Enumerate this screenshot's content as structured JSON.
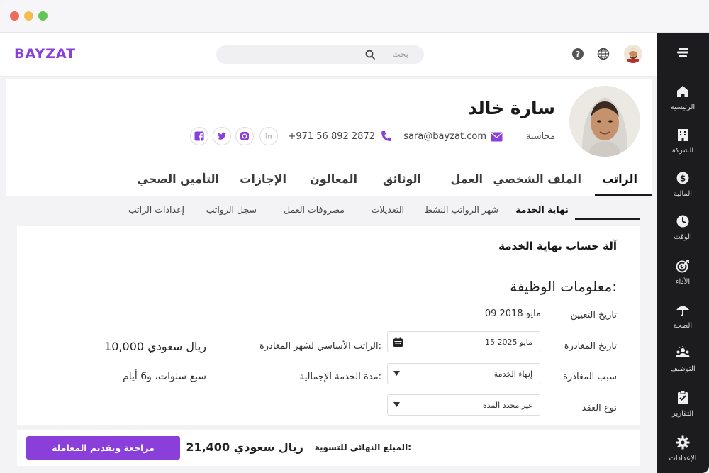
{
  "header": {
    "logo": "BAYZAT",
    "search_placeholder": "بحث"
  },
  "profile": {
    "name": "سارة خالد",
    "role": "محاسبة",
    "email": "sara@bayzat.com",
    "phone": "+971 56 892 2872"
  },
  "tabs": [
    {
      "label": "الراتب"
    },
    {
      "label": "الملف الشخصي"
    },
    {
      "label": "العمل"
    },
    {
      "label": "الوثائق"
    },
    {
      "label": "المعالون"
    },
    {
      "label": "الإجازات"
    },
    {
      "label": "التأمين الصحي"
    }
  ],
  "subtabs": [
    {
      "label": "نهاية الخدمة"
    },
    {
      "label": "شهر الرواتب النشط"
    },
    {
      "label": "التعديلات"
    },
    {
      "label": "مصروفات العمل"
    },
    {
      "label": "سجل الرواتب"
    },
    {
      "label": "إعدادات الراتب"
    }
  ],
  "calculator": {
    "title": "آلة حساب نهاية الخدمة",
    "section_title": "معلومات الوظيفة:",
    "hire_date_label": "تاريخ التعيين",
    "hire_date_value": "09 مايو 2018",
    "departure_date_label": "تاريخ المغادرة",
    "departure_date_value": "15 مايو 2025",
    "departure_reason_label": "سبب المغادرة",
    "departure_reason_value": "إنهاء الخدمة",
    "contract_type_label": "نوع العقد",
    "contract_type_value": "غير محدد المدة",
    "base_salary_label": "الراتب الأساسي لشهر المغادرة:",
    "base_salary_value": "10,000 ريال سعودي",
    "service_duration_label": "مدة الخدمة الإجمالية:",
    "service_duration_value": "سبع سنوات، و6 أيام"
  },
  "settlement": {
    "label": "المبلغ النهائي للتسوية:",
    "amount": "21,400 ريال سعودي",
    "submit_label": "مراجعة وتقديم المعاملة"
  },
  "sidebar": {
    "items": [
      {
        "label": "الرئيسية",
        "icon": "home-icon"
      },
      {
        "label": "الشركة",
        "icon": "building-icon"
      },
      {
        "label": "المالية",
        "icon": "dollar-icon"
      },
      {
        "label": "الوقت",
        "icon": "clock-icon"
      },
      {
        "label": "الأداء",
        "icon": "target-icon"
      },
      {
        "label": "الصحة",
        "icon": "umbrella-icon"
      },
      {
        "label": "التوظيف",
        "icon": "people-icon"
      },
      {
        "label": "التقارير",
        "icon": "clipboard-icon"
      },
      {
        "label": "الإعدادات",
        "icon": "gear-icon"
      }
    ]
  },
  "colors": {
    "brand": "#8a3fdb",
    "sidebar": "#1c1c1e"
  }
}
